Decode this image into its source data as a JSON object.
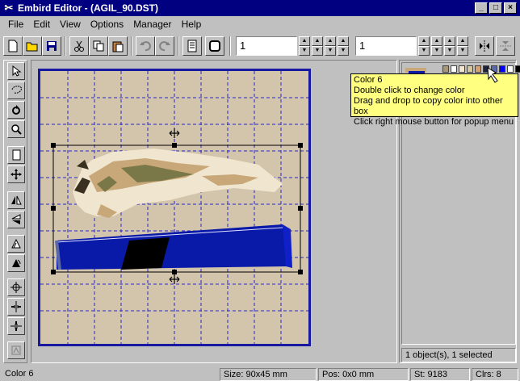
{
  "window": {
    "title": "Embird Editor - (AGIL_90.DST)",
    "minimize_glyph": "_",
    "maximize_glyph": "□",
    "close_glyph": "×"
  },
  "menu": [
    {
      "label": "File"
    },
    {
      "label": "Edit"
    },
    {
      "label": "View"
    },
    {
      "label": "Options"
    },
    {
      "label": "Manager"
    },
    {
      "label": "Help"
    }
  ],
  "toolbar": {
    "value_1": "1",
    "value_2": "1"
  },
  "palette": {
    "colors": [
      "#a89878",
      "#ffffff",
      "#f4e6cc",
      "#d8c8a0",
      "#d8a070",
      "#202040",
      "#5868a8",
      "#0000ff",
      "#ffffff",
      "#000000"
    ]
  },
  "tooltip": {
    "line1": "Color 6",
    "line2": "Double click to change color",
    "line3": "Drag and drop to copy color into other box",
    "line4": "Click right mouse button for popup menu"
  },
  "right_panel": {
    "object_count": "1 object(s), 1 selected"
  },
  "status": {
    "color": "Color 6",
    "size": "Size: 90x45 mm",
    "pos": "Pos: 0x0 mm",
    "stitches": "St: 9183",
    "colors": "Clrs: 8"
  },
  "design": {
    "thread_colors": [
      "#f0e6d0",
      "#c8a878",
      "#7a7848",
      "#3a3020",
      "#0a1aa8",
      "#000000"
    ]
  }
}
